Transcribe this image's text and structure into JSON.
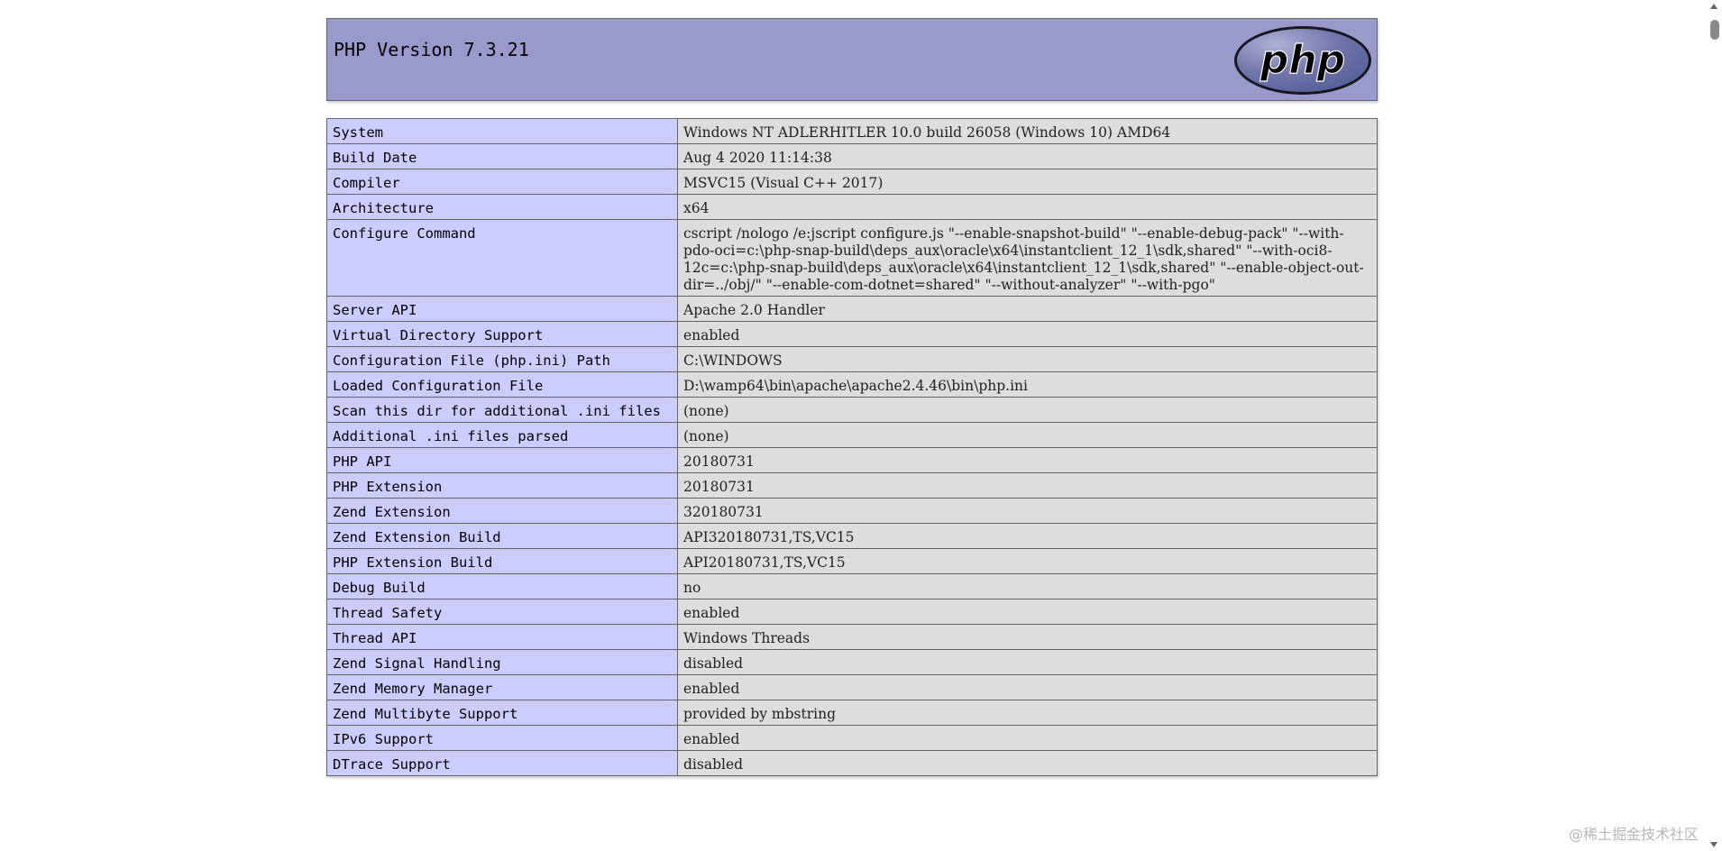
{
  "header": {
    "title": "PHP Version 7.3.21",
    "logo_text": "php"
  },
  "rows": [
    {
      "key": "System",
      "value": "Windows NT ADLERHITLER 10.0 build 26058 (Windows 10) AMD64"
    },
    {
      "key": "Build Date",
      "value": "Aug 4 2020 11:14:38"
    },
    {
      "key": "Compiler",
      "value": "MSVC15 (Visual C++ 2017)"
    },
    {
      "key": "Architecture",
      "value": "x64"
    },
    {
      "key": "Configure Command",
      "value": "cscript /nologo /e:jscript configure.js \"--enable-snapshot-build\" \"--enable-debug-pack\" \"--with-pdo-oci=c:\\php-snap-build\\deps_aux\\oracle\\x64\\instantclient_12_1\\sdk,shared\" \"--with-oci8-12c=c:\\php-snap-build\\deps_aux\\oracle\\x64\\instantclient_12_1\\sdk,shared\" \"--enable-object-out-dir=../obj/\" \"--enable-com-dotnet=shared\" \"--without-analyzer\" \"--with-pgo\""
    },
    {
      "key": "Server API",
      "value": "Apache 2.0 Handler"
    },
    {
      "key": "Virtual Directory Support",
      "value": "enabled"
    },
    {
      "key": "Configuration File (php.ini) Path",
      "value": "C:\\WINDOWS"
    },
    {
      "key": "Loaded Configuration File",
      "value": "D:\\wamp64\\bin\\apache\\apache2.4.46\\bin\\php.ini"
    },
    {
      "key": "Scan this dir for additional .ini files",
      "value": "(none)"
    },
    {
      "key": "Additional .ini files parsed",
      "value": "(none)"
    },
    {
      "key": "PHP API",
      "value": "20180731"
    },
    {
      "key": "PHP Extension",
      "value": "20180731"
    },
    {
      "key": "Zend Extension",
      "value": "320180731"
    },
    {
      "key": "Zend Extension Build",
      "value": "API320180731,TS,VC15"
    },
    {
      "key": "PHP Extension Build",
      "value": "API20180731,TS,VC15"
    },
    {
      "key": "Debug Build",
      "value": "no"
    },
    {
      "key": "Thread Safety",
      "value": "enabled"
    },
    {
      "key": "Thread API",
      "value": "Windows Threads"
    },
    {
      "key": "Zend Signal Handling",
      "value": "disabled"
    },
    {
      "key": "Zend Memory Manager",
      "value": "enabled"
    },
    {
      "key": "Zend Multibyte Support",
      "value": "provided by mbstring"
    },
    {
      "key": "IPv6 Support",
      "value": "enabled"
    },
    {
      "key": "DTrace Support",
      "value": "disabled"
    }
  ],
  "watermark": "@稀土掘金技术社区",
  "colors": {
    "header_bg": "#9999cc",
    "key_bg": "#ccccff",
    "value_bg": "#dddddd"
  }
}
